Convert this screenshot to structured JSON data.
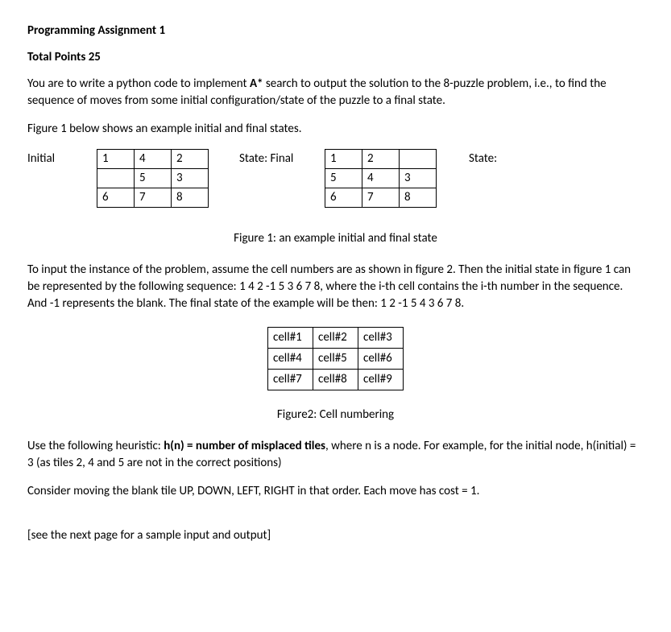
{
  "title": "Programming Assignment 1",
  "points_line": "Total Points 25",
  "intro_p1_pre": "You are to write a python code to implement ",
  "intro_p1_bold": "A*",
  "intro_p1_post": " search to output the solution to the 8-puzzle problem, i.e., to find the sequence of moves from some initial configuration/state of the puzzle to a final state.",
  "intro_p2": "Figure 1 below shows an example initial and final states.",
  "label_initial": "Initial",
  "label_state_final": "State:  Final",
  "label_state": "State:",
  "initial_grid": {
    "r0c0": "1",
    "r0c1": "4",
    "r0c2": "2",
    "r1c0": "",
    "r1c1": "5",
    "r1c2": "3",
    "r2c0": "6",
    "r2c1": "7",
    "r2c2": "8"
  },
  "final_grid": {
    "r0c0": "1",
    "r0c1": "2",
    "r0c2": "",
    "r1c0": "5",
    "r1c1": "4",
    "r1c2": "3",
    "r2c0": "6",
    "r2c1": "7",
    "r2c2": "8"
  },
  "fig1_caption": "Figure 1: an example initial and final state",
  "para_input": "To input the instance of the problem, assume the cell numbers are as shown in figure 2. Then the initial state in figure 1 can be represented by the following sequence: 1 4 2 -1 5 3 6 7 8, where the i-th cell contains the i-th number in the sequence. And -1 represents the blank. The final state of the example will be then: 1 2 -1 5 4 3 6 7 8.",
  "cells_grid": {
    "r0c0": "cell#1",
    "r0c1": "cell#2",
    "r0c2": "cell#3",
    "r1c0": "cell#4",
    "r1c1": "cell#5",
    "r1c2": "cell#6",
    "r2c0": "cell#7",
    "r2c1": "cell#8",
    "r2c2": "cell#9"
  },
  "fig2_caption": "Figure2: Cell numbering",
  "heuristic_pre": "Use the following heuristic: ",
  "heuristic_bold": "h(n) = number of misplaced tiles",
  "heuristic_post": ", where n is a node. For example, for the initial node, h(initial) = 3 (as tiles 2, 4 and 5 are not in the correct positions)",
  "order_line": "Consider moving the blank tile UP, DOWN, LEFT, RIGHT in that order. Each move has cost = 1.",
  "next_page": "[see the next page for a sample input and output]"
}
